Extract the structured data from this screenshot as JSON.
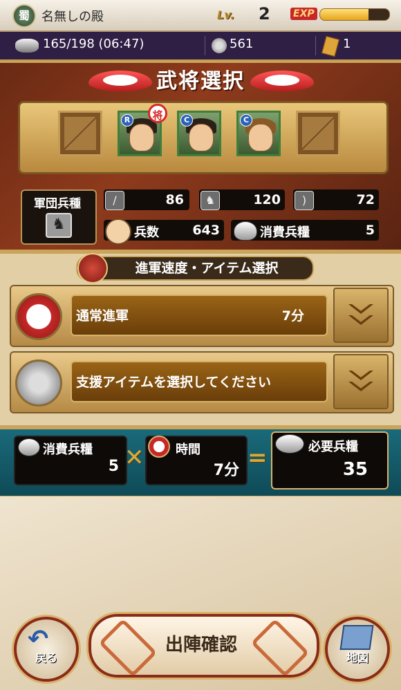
{
  "player": {
    "faction": "蜀",
    "name": "名無しの殿",
    "level_label": "Lv.",
    "level": "2",
    "exp_label": "EXP",
    "exp_progress": 0.7
  },
  "resources": {
    "stamina": "165/198 (06:47)",
    "coins": "561",
    "tickets": "1"
  },
  "general_select": {
    "title": "武将選択",
    "slots": [
      {
        "type": "empty"
      },
      {
        "type": "general",
        "rank": "R",
        "leader": true,
        "leader_label": "将"
      },
      {
        "type": "general",
        "rank": "C"
      },
      {
        "type": "general",
        "rank": "C"
      },
      {
        "type": "empty"
      }
    ],
    "unit_label": "軍団兵種",
    "stats": {
      "sword": "86",
      "horse": "120",
      "bow": "72"
    },
    "troops_label": "兵数",
    "troops": "643",
    "food_label": "消費兵糧",
    "food": "5"
  },
  "march": {
    "title": "進軍速度・アイテム選択",
    "speed_label": "通常進軍",
    "speed_time": "7分",
    "item_placeholder": "支援アイテムを選択してください"
  },
  "cost": {
    "food_label": "消費兵糧",
    "food_value": "5",
    "time_label": "時間",
    "time_value": "7分",
    "required_label": "必要兵糧",
    "required_value": "35"
  },
  "buttons": {
    "back": "戻る",
    "confirm": "出陣確認",
    "map": "地図"
  }
}
